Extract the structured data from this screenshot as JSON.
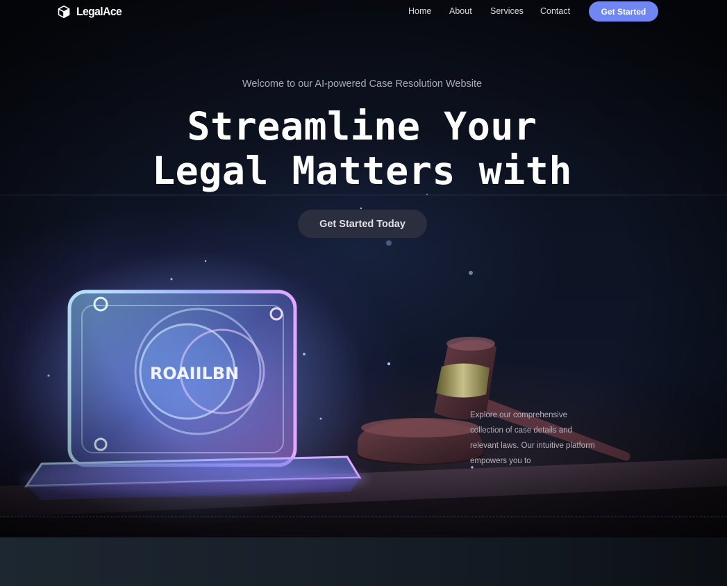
{
  "brand": {
    "name": "LegalAce",
    "logo_icon": "cube-icon"
  },
  "nav": {
    "links": [
      "Home",
      "About",
      "Services",
      "Contact"
    ],
    "cta_label": "Get Started",
    "cta_color": "#6f86f3"
  },
  "hero": {
    "eyebrow": "Welcome to our AI-powered Case Resolution Website",
    "headline_line1": "Streamline Your",
    "headline_line2": "Legal Matters with",
    "cta_label": "Get Started Today",
    "blurb": "Explore our comprehensive collection of case details and relevant laws. Our intuitive platform empowers you to",
    "artwork_sign_text": "ROAIILBN",
    "artwork_icons": [
      "glowing-glass-sign-illustration",
      "gavel-illustration"
    ]
  },
  "colors": {
    "background": "#0d1322",
    "heading": "#ffffff",
    "accent": "#6f86f3"
  }
}
